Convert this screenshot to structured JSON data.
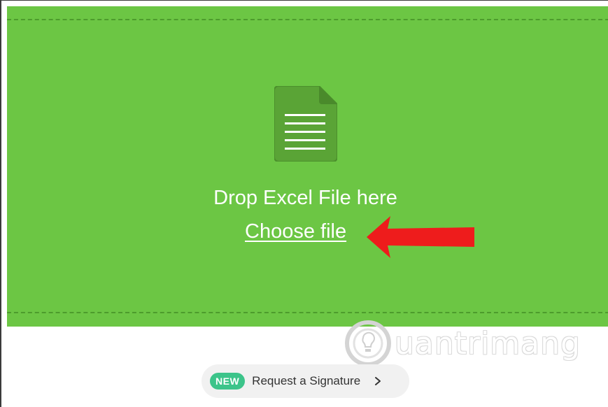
{
  "dropzone": {
    "title": "Drop Excel File here",
    "choose_file": "Choose file",
    "background_color": "#6cc644",
    "icon": "spreadsheet-file-icon"
  },
  "annotation": {
    "icon": "red-arrow-icon",
    "color": "#ee1c1c"
  },
  "watermark": {
    "text": "uantrimang"
  },
  "signature_promo": {
    "badge": "NEW",
    "label": "Request a Signature",
    "icon": "chevron-right-icon",
    "badge_color": "#3cc48a"
  }
}
